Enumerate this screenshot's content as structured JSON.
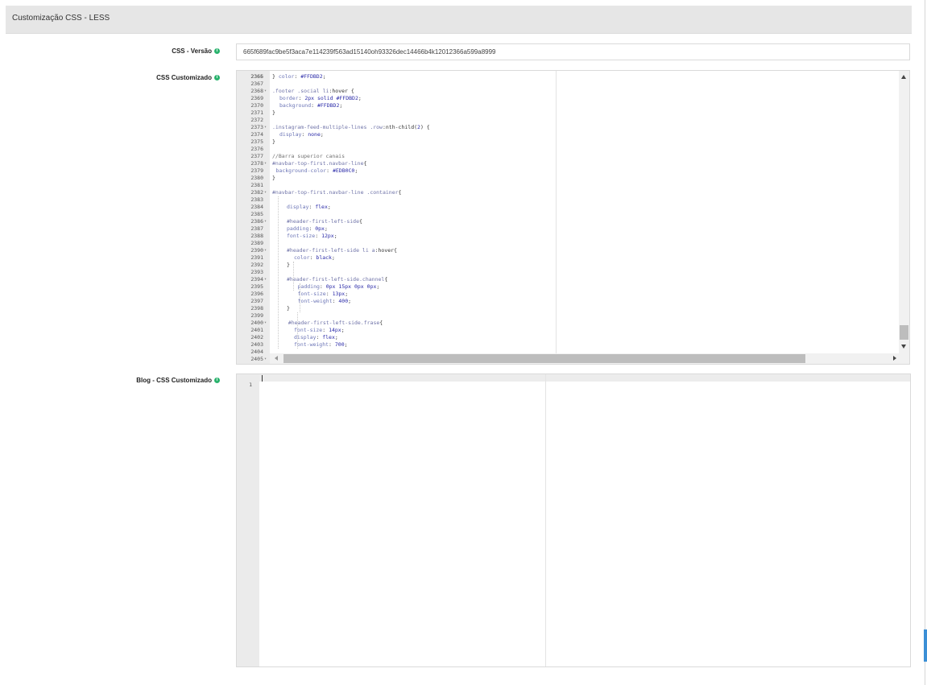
{
  "page": {
    "section_title": "Customização CSS - LESS"
  },
  "fields": {
    "css_version": {
      "label": "CSS - Versão",
      "value": "665f689fac9be5f3aca7e114239f563ad15140oh93326dec14466b4k12012366a599a8999"
    },
    "custom_css": {
      "label": "CSS Customizado"
    },
    "blog_css": {
      "label": "Blog - CSS Customizado"
    }
  },
  "editor": {
    "lines": [
      {
        "n": "2366",
        "fold": "",
        "indent": 0,
        "parts": [
          [
            "c-brace",
            "}"
          ]
        ]
      },
      {
        "n": "2367",
        "fold": "",
        "indent": 0,
        "parts": []
      },
      {
        "n": "2368",
        "fold": "▾",
        "indent": 0,
        "parts": [
          [
            "c-sel",
            ".footer .social li"
          ],
          [
            "c-plain",
            ":hover {"
          ]
        ]
      },
      {
        "n": "2369",
        "fold": "",
        "indent": 1,
        "parts": [
          [
            "c-kw",
            "border"
          ],
          [
            "c-plain",
            ": "
          ],
          [
            "c-num",
            "2px"
          ],
          [
            "c-plain",
            " "
          ],
          [
            "c-val",
            "solid"
          ],
          [
            "c-plain",
            " "
          ],
          [
            "c-val",
            "#FFDBD2"
          ],
          [
            "c-plain",
            ";"
          ]
        ]
      },
      {
        "n": "2370",
        "fold": "",
        "indent": 1,
        "parts": [
          [
            "c-kw",
            "background"
          ],
          [
            "c-plain",
            ": "
          ],
          [
            "c-val",
            "#FFDBD2"
          ],
          [
            "c-plain",
            ";"
          ]
        ]
      },
      {
        "n": "2371",
        "fold": "",
        "indent": 0,
        "parts": [
          [
            "c-brace",
            "}"
          ]
        ]
      },
      {
        "n": "2372",
        "fold": "",
        "indent": 0,
        "parts": []
      },
      {
        "n": "2373",
        "fold": "▾",
        "indent": 0,
        "parts": [
          [
            "c-sel",
            ".instagram-feed-multiple-lines .row"
          ],
          [
            "c-plain",
            ":nth-child("
          ],
          [
            "c-num",
            "2"
          ],
          [
            "c-plain",
            ") {"
          ]
        ]
      },
      {
        "n": "2374",
        "fold": "",
        "indent": 1,
        "parts": [
          [
            "c-kw",
            "display"
          ],
          [
            "c-plain",
            ": "
          ],
          [
            "c-val",
            "none"
          ],
          [
            "c-plain",
            ";"
          ]
        ]
      },
      {
        "n": "2375",
        "fold": "",
        "indent": 0,
        "parts": [
          [
            "c-brace",
            "}"
          ]
        ]
      },
      {
        "n": "2376",
        "fold": "",
        "indent": 0,
        "parts": []
      },
      {
        "n": "2377",
        "fold": "",
        "indent": 0,
        "parts": [
          [
            "c-com",
            "//Barra superior canais"
          ]
        ]
      },
      {
        "n": "2378",
        "fold": "▾",
        "indent": 0,
        "parts": [
          [
            "c-sel",
            "#navbar-top-first.navbar-line"
          ],
          [
            "c-plain",
            "{"
          ]
        ]
      },
      {
        "n": "2379",
        "fold": "",
        "indent": 0.5,
        "parts": [
          [
            "c-kw",
            "background-color"
          ],
          [
            "c-plain",
            ": "
          ],
          [
            "c-val",
            "#EDB0C0"
          ],
          [
            "c-plain",
            ";"
          ]
        ]
      },
      {
        "n": "2380",
        "fold": "",
        "indent": 0,
        "parts": [
          [
            "c-brace",
            "}"
          ]
        ]
      },
      {
        "n": "2381",
        "fold": "",
        "indent": 0,
        "parts": []
      },
      {
        "n": "2382",
        "fold": "▾",
        "indent": 0,
        "parts": [
          [
            "c-sel",
            "#navbar-top-first.navbar-line .container"
          ],
          [
            "c-plain",
            "{"
          ]
        ]
      },
      {
        "n": "2383",
        "fold": "",
        "indent": 0,
        "parts": []
      },
      {
        "n": "2384",
        "fold": "",
        "indent": 2,
        "parts": [
          [
            "c-kw",
            "display"
          ],
          [
            "c-plain",
            ": "
          ],
          [
            "c-val",
            "flex"
          ],
          [
            "c-plain",
            ";"
          ]
        ]
      },
      {
        "n": "2385",
        "fold": "",
        "indent": 0,
        "parts": []
      },
      {
        "n": "2386",
        "fold": "▾",
        "indent": 2,
        "parts": [
          [
            "c-sel",
            "#header-first-left-side"
          ],
          [
            "c-plain",
            "{"
          ]
        ]
      },
      {
        "n": "2387",
        "fold": "",
        "indent": 2,
        "parts": [
          [
            "c-kw",
            "padding"
          ],
          [
            "c-plain",
            ": "
          ],
          [
            "c-num",
            "0px"
          ],
          [
            "c-plain",
            ";"
          ]
        ]
      },
      {
        "n": "2388",
        "fold": "",
        "indent": 2,
        "parts": [
          [
            "c-kw",
            "font-size"
          ],
          [
            "c-plain",
            ": "
          ],
          [
            "c-num",
            "12px"
          ],
          [
            "c-plain",
            ";"
          ]
        ]
      },
      {
        "n": "2389",
        "fold": "",
        "indent": 0,
        "parts": []
      },
      {
        "n": "2390",
        "fold": "▾",
        "indent": 2,
        "parts": [
          [
            "c-sel",
            "#header-first-left-side li a"
          ],
          [
            "c-plain",
            ":hover{"
          ]
        ]
      },
      {
        "n": "2391",
        "fold": "",
        "indent": 3,
        "parts": [
          [
            "c-kw",
            "color"
          ],
          [
            "c-plain",
            ": "
          ],
          [
            "c-val",
            "black"
          ],
          [
            "c-plain",
            ";"
          ]
        ]
      },
      {
        "n": "2392",
        "fold": "",
        "indent": 2,
        "parts": [
          [
            "c-brace",
            "}"
          ]
        ]
      },
      {
        "n": "2393",
        "fold": "",
        "indent": 0,
        "parts": []
      },
      {
        "n": "2394",
        "fold": "▾",
        "indent": 2,
        "parts": [
          [
            "c-sel",
            "#header-first-left-side.channel"
          ],
          [
            "c-plain",
            "{"
          ]
        ]
      },
      {
        "n": "2395",
        "fold": "",
        "indent": 3.5,
        "parts": [
          [
            "c-kw",
            "padding"
          ],
          [
            "c-plain",
            ": "
          ],
          [
            "c-num",
            "0px"
          ],
          [
            "c-plain",
            " "
          ],
          [
            "c-num",
            "15px"
          ],
          [
            "c-plain",
            " "
          ],
          [
            "c-num",
            "0px"
          ],
          [
            "c-plain",
            " "
          ],
          [
            "c-num",
            "0px"
          ],
          [
            "c-plain",
            ";"
          ]
        ]
      },
      {
        "n": "2396",
        "fold": "",
        "indent": 3.5,
        "parts": [
          [
            "c-kw",
            "font-size"
          ],
          [
            "c-plain",
            ": "
          ],
          [
            "c-num",
            "13px"
          ],
          [
            "c-plain",
            ";"
          ]
        ]
      },
      {
        "n": "2397",
        "fold": "",
        "indent": 3.5,
        "parts": [
          [
            "c-kw",
            "font-weight"
          ],
          [
            "c-plain",
            ": "
          ],
          [
            "c-num",
            "400"
          ],
          [
            "c-plain",
            ";"
          ]
        ]
      },
      {
        "n": "2398",
        "fold": "",
        "indent": 2,
        "parts": [
          [
            "c-brace",
            "}"
          ]
        ]
      },
      {
        "n": "2399",
        "fold": "",
        "indent": 0,
        "parts": []
      },
      {
        "n": "2400",
        "fold": "▾",
        "indent": 2.2,
        "parts": [
          [
            "c-sel",
            "#header-first-left-side.frase"
          ],
          [
            "c-plain",
            "{"
          ]
        ]
      },
      {
        "n": "2401",
        "fold": "",
        "indent": 3,
        "parts": [
          [
            "c-kw",
            "font-size"
          ],
          [
            "c-plain",
            ": "
          ],
          [
            "c-num",
            "14px"
          ],
          [
            "c-plain",
            ";"
          ]
        ]
      },
      {
        "n": "2402",
        "fold": "",
        "indent": 3,
        "parts": [
          [
            "c-kw",
            "display"
          ],
          [
            "c-plain",
            ": "
          ],
          [
            "c-val",
            "flex"
          ],
          [
            "c-plain",
            ";"
          ]
        ]
      },
      {
        "n": "2403",
        "fold": "",
        "indent": 3,
        "parts": [
          [
            "c-kw",
            "font-weight"
          ],
          [
            "c-plain",
            ": "
          ],
          [
            "c-num",
            "700"
          ],
          [
            "c-plain",
            ";"
          ]
        ]
      },
      {
        "n": "2404",
        "fold": "",
        "indent": 0,
        "parts": []
      },
      {
        "n": "2405",
        "fold": "▾",
        "indent": 0,
        "parts": []
      }
    ]
  },
  "blog_editor": {
    "line_number": "1"
  }
}
